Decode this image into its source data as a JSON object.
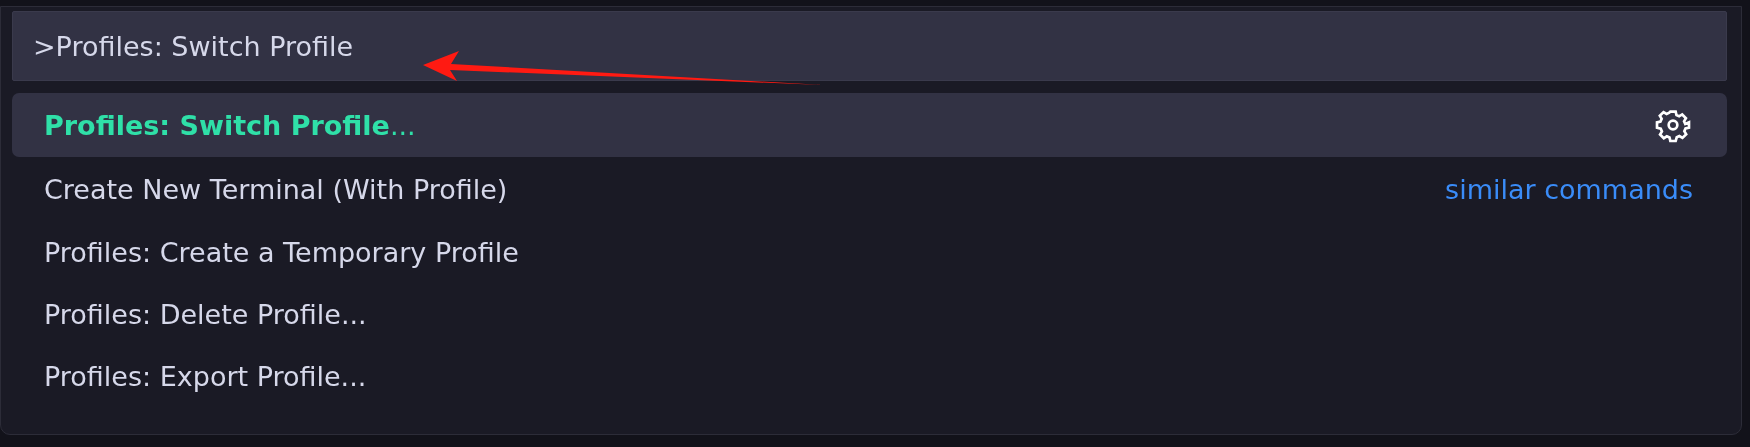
{
  "input": {
    "value": ">Profiles: Switch Profile"
  },
  "items": [
    {
      "label": "**Profiles: Switch Profile**...",
      "selected": true,
      "kind": "gear"
    },
    {
      "label": "Create New Terminal (With Profile)",
      "selected": false,
      "kind": "link",
      "link": "similar commands"
    },
    {
      "label": "Profiles: Create a Temporary Profile",
      "selected": false,
      "kind": "plain"
    },
    {
      "label": "Profiles: Delete Profile...",
      "selected": false,
      "kind": "plain"
    },
    {
      "label": "Profiles: Export Profile...",
      "selected": false,
      "kind": "plain"
    }
  ]
}
